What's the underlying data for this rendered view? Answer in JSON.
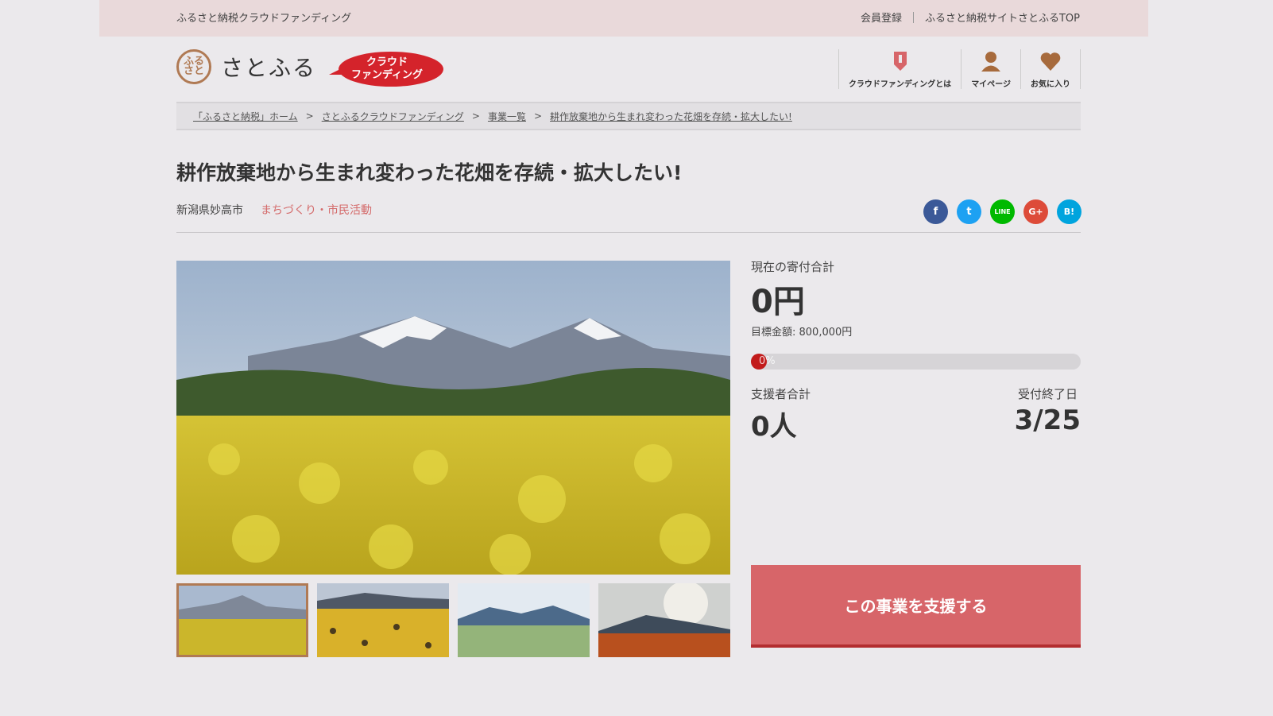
{
  "topbar": {
    "site_name": "ふるさと納税クラウドファンディング",
    "links": [
      "会員登録",
      "ふるさと納税サイトさとふるTOP"
    ]
  },
  "header": {
    "logo_mark": "ふるさと",
    "logo_text": "さとふる",
    "badge_line1": "クラウド",
    "badge_line2": "ファンディング",
    "nav": [
      {
        "label": "クラウドファンディングとは",
        "icon": "badge-icon"
      },
      {
        "label": "マイページ",
        "icon": "user-icon"
      },
      {
        "label": "お気に入り",
        "icon": "heart-icon"
      }
    ]
  },
  "breadcrumb": [
    "「ふるさと納税」ホーム",
    "さとふるクラウドファンディング",
    "事業一覧",
    "耕作放棄地から生まれ変わった花畑を存続・拡大したい!"
  ],
  "project": {
    "title": "耕作放棄地から生まれ変わった花畑を存続・拡大したい!",
    "place": "新潟県妙高市",
    "category": "まちづくり・市民活動"
  },
  "share": [
    {
      "name": "facebook",
      "glyph": "f",
      "color": "#3b5998"
    },
    {
      "name": "twitter",
      "glyph": "t",
      "color": "#1da1f2"
    },
    {
      "name": "line",
      "glyph": "LINE",
      "color": "#00b900"
    },
    {
      "name": "google-plus",
      "glyph": "G+",
      "color": "#dd4b39"
    },
    {
      "name": "hatena",
      "glyph": "B!",
      "color": "#00a4de"
    }
  ],
  "stats": {
    "total_label": "現在の寄付合計",
    "total_value": "0円",
    "goal": "目標金額: 800,000円",
    "progress_text": "0%",
    "progress": 0,
    "supporters_label": "支援者合計",
    "supporters_value": "0人",
    "deadline_label": "受付終了日",
    "deadline_value": "3/25"
  },
  "support_button": "この事業を支援する",
  "colors": {
    "accent": "#d76569",
    "brand": "#b07a54",
    "badge": "#d4232b"
  }
}
